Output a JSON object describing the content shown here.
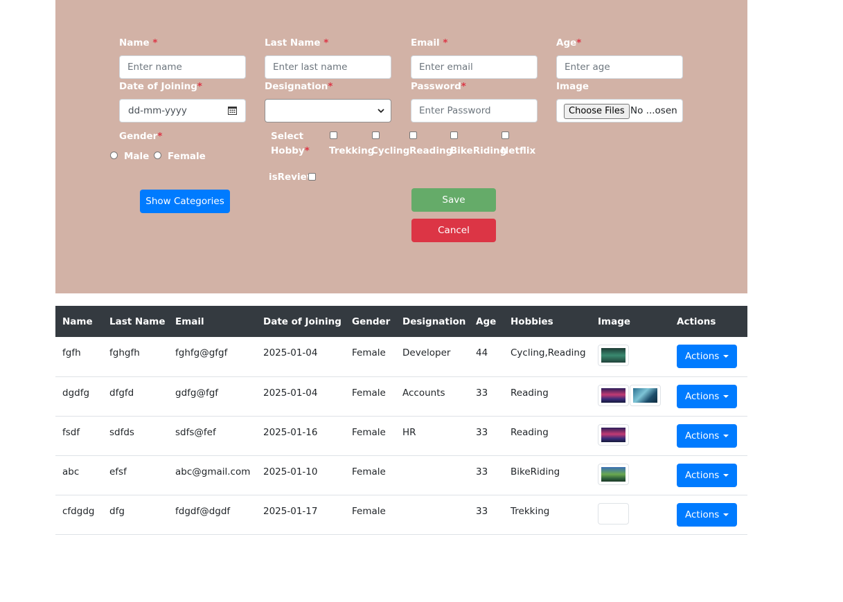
{
  "form": {
    "name_label": "Name",
    "name_placeholder": "Enter name",
    "last_name_label": "Last Name",
    "last_name_placeholder": "Enter last name",
    "email_label": "Email",
    "email_placeholder": "Enter email",
    "age_label": "Age",
    "age_placeholder": "Enter age",
    "doj_label": "Date of Joining",
    "doj_placeholder": "dd-mm-yyyy",
    "designation_label": "Designation",
    "designation_value": "",
    "password_label": "Password",
    "password_placeholder": "Enter Password",
    "image_label": "Image",
    "file_button": "Choose Files",
    "file_status": "No ...osen",
    "gender_label": "Gender",
    "gender_options": [
      "Male",
      "Female"
    ],
    "hobby_label_line1": "Select",
    "hobby_label_line2": "Hobby",
    "hobbies": [
      "Trekking",
      "Cycling",
      "Reading",
      "BikeRiding",
      "Netflix"
    ],
    "is_review_label": "isReview",
    "required_mark": "*",
    "show_categories_label": "Show Categories",
    "save_label": "Save",
    "cancel_label": "Cancel"
  },
  "colors": {
    "panel": "#d2b2a6",
    "primary": "#007bff",
    "save": "#65ab69",
    "cancel": "#dc3545",
    "table_header": "#343a40"
  },
  "table": {
    "headers": [
      "Name",
      "Last Name",
      "Email",
      "Date of Joining",
      "Gender",
      "Designation",
      "Age",
      "Hobbies",
      "Image",
      "Actions"
    ],
    "action_label": "Actions",
    "rows": [
      {
        "name": "fgfh",
        "last_name": "fghgfh",
        "email": "fghfg@gfgf",
        "doj": "2025-01-04",
        "gender": "Female",
        "designation": "Developer",
        "age": "44",
        "hobbies": "Cycling,Reading",
        "images": [
          "lake-thumbnail"
        ]
      },
      {
        "name": "dgdfg",
        "last_name": "dfgfd",
        "email": "gdfg@fgf",
        "doj": "2025-01-04",
        "gender": "Female",
        "designation": "Accounts",
        "age": "33",
        "hobbies": "Reading",
        "images": [
          "sunset-thumbnail",
          "river-thumbnail"
        ]
      },
      {
        "name": "fsdf",
        "last_name": "sdfds",
        "email": "sdfs@fef",
        "doj": "2025-01-16",
        "gender": "Female",
        "designation": "HR",
        "age": "33",
        "hobbies": "Reading",
        "images": [
          "sunset-thumbnail"
        ]
      },
      {
        "name": "abc",
        "last_name": "efsf",
        "email": "abc@gmail.com",
        "doj": "2025-01-10",
        "gender": "Female",
        "designation": "",
        "age": "33",
        "hobbies": "BikeRiding",
        "images": [
          "valley-thumbnail"
        ]
      },
      {
        "name": "cfdgdg",
        "last_name": "dfg",
        "email": "fdgdf@dgdf",
        "doj": "2025-01-17",
        "gender": "Female",
        "designation": "",
        "age": "33",
        "hobbies": "Trekking",
        "images": [
          "broken-image-thumbnail"
        ]
      }
    ]
  }
}
